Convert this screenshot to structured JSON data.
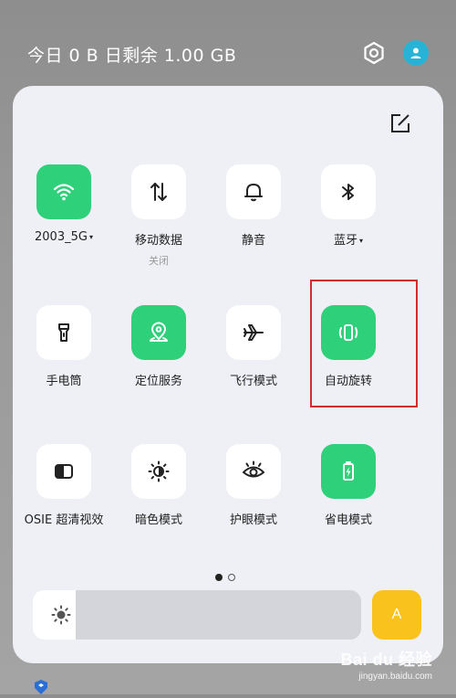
{
  "status_bar": {
    "data_usage": "今日 0 B 日剩余 1.00 GB"
  },
  "tiles": [
    {
      "label": "2003_5G",
      "caret": "▾",
      "sublabel": "",
      "active": true,
      "icon": "wifi-icon"
    },
    {
      "label": "移动数据",
      "caret": "",
      "sublabel": "关闭",
      "active": false,
      "icon": "mobile-data-icon"
    },
    {
      "label": "静音",
      "caret": "",
      "sublabel": "",
      "active": false,
      "icon": "bell-icon"
    },
    {
      "label": "蓝牙",
      "caret": "▾",
      "sublabel": "",
      "active": false,
      "icon": "bluetooth-icon"
    },
    {
      "label": "手电筒",
      "caret": "",
      "sublabel": "",
      "active": false,
      "icon": "flashlight-icon"
    },
    {
      "label": "定位服务",
      "caret": "",
      "sublabel": "",
      "active": true,
      "icon": "location-icon"
    },
    {
      "label": "飞行模式",
      "caret": "",
      "sublabel": "",
      "active": false,
      "icon": "airplane-icon"
    },
    {
      "label": "自动旋转",
      "caret": "",
      "sublabel": "",
      "active": true,
      "icon": "auto-rotate-icon"
    },
    {
      "label": "OSIE 超清视效",
      "caret": "",
      "sublabel": "",
      "active": false,
      "icon": "osie-icon"
    },
    {
      "label": "暗色模式",
      "caret": "",
      "sublabel": "",
      "active": false,
      "icon": "dark-mode-icon"
    },
    {
      "label": "护眼模式",
      "caret": "",
      "sublabel": "",
      "active": false,
      "icon": "eye-icon"
    },
    {
      "label": "省电模式",
      "caret": "",
      "sublabel": "",
      "active": true,
      "icon": "battery-saver-icon"
    }
  ],
  "pager": {
    "current": 1,
    "total": 2
  },
  "brightness": {
    "level": 0.13
  },
  "auto_brightness": {
    "label": "A"
  },
  "colors": {
    "accent_green": "#2fd07a",
    "auto_yellow": "#f9c21d",
    "highlight_red": "#d22c2c",
    "account_blue": "#28b3d6"
  },
  "watermark": {
    "brand": "Bai du 经验",
    "url": "jingyan.baidu.com"
  }
}
